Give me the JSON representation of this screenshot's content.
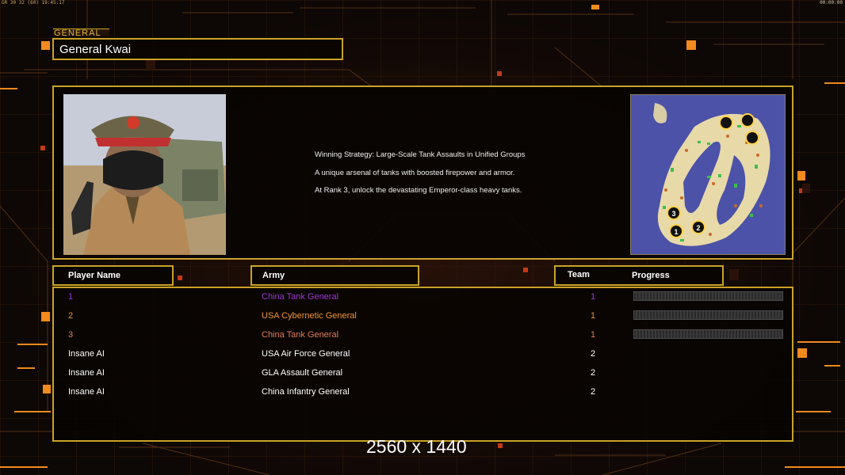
{
  "hud": {
    "left": "GR 30 32 (60) 19:45:17",
    "right": "00:00:00"
  },
  "general": {
    "tag": "GENERAL",
    "name": "General Kwai"
  },
  "info": {
    "strategy_lines": [
      "Winning Strategy: Large-Scale Tank Assaults in Unified Groups",
      "A unique arsenal of tanks with boosted firepower and armor.",
      "At Rank 3, unlock the devastating Emperor-class heavy tanks."
    ],
    "start_positions": [
      "1",
      "2",
      "3"
    ]
  },
  "table": {
    "headers": {
      "player_name": "Player Name",
      "army": "Army",
      "team": "Team",
      "progress": "Progress"
    },
    "rows": [
      {
        "name": "1",
        "army": "China Tank General",
        "team": "1",
        "color": "#9b37d6",
        "progress": true
      },
      {
        "name": "2",
        "army": "USA Cybernetic General",
        "team": "1",
        "color": "#f2962e",
        "progress": true
      },
      {
        "name": "3",
        "army": "China Tank General",
        "team": "1",
        "color": "#e07a5a",
        "progress": true
      },
      {
        "name": "Insane AI",
        "army": "USA Air Force General",
        "team": "2",
        "color": "#ffffff",
        "progress": false
      },
      {
        "name": "Insane AI",
        "army": "GLA Assault General",
        "team": "2",
        "color": "#ffffff",
        "progress": false
      },
      {
        "name": "Insane AI",
        "army": "China Infantry General",
        "team": "2",
        "color": "#ffffff",
        "progress": false
      }
    ]
  },
  "watermark": "2560 x 1440",
  "colors": {
    "accent_gold": "#c9a227",
    "orange": "#f2962e",
    "background": "#0d0705"
  }
}
